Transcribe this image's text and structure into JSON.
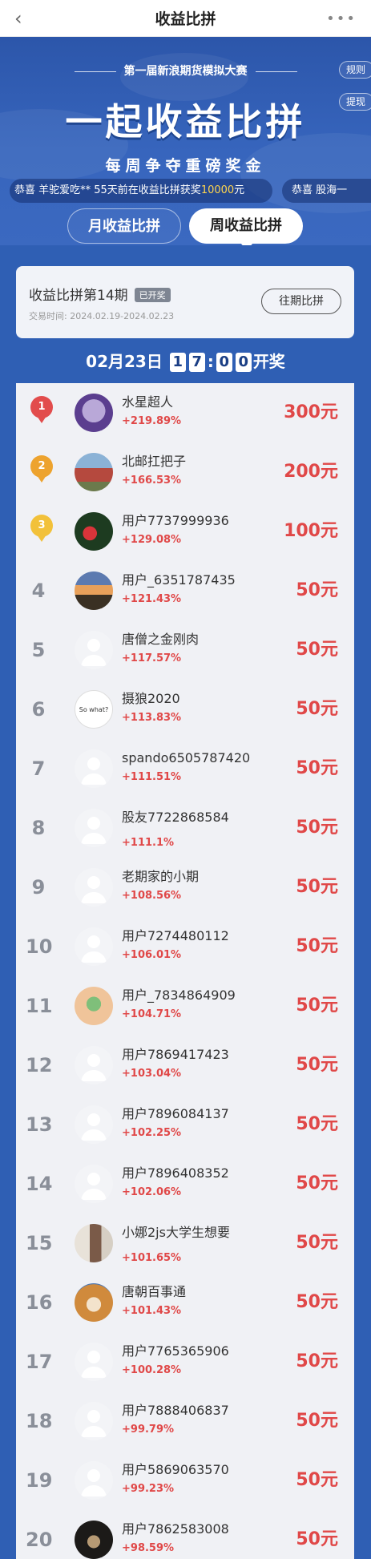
{
  "nav": {
    "back_icon": "back-chevron-icon",
    "title": "收益比拼",
    "more_icon": "more-dots-icon"
  },
  "hero": {
    "contest_title": "第一届新浪期货模拟大赛",
    "side_buttons": [
      "规则",
      "提现"
    ],
    "main_title": "一起收益比拼",
    "subtitle": "每周争夺重磅奖金",
    "marquee1": {
      "prefix": "恭喜 羊驼爱吃** 55天前在收益比拼获奖",
      "amount": "10000",
      "suffix": "元"
    },
    "marquee2": "恭喜 股海一"
  },
  "tabs": {
    "month": "月收益比拼",
    "week": "周收益比拼",
    "active": "week"
  },
  "period": {
    "title": "收益比拼第14期",
    "badge": "已开奖",
    "date": "交易时间: 2024.02.19-2024.02.23",
    "history_btn": "往期比拼"
  },
  "countdown": {
    "date": "02月23日",
    "digits": [
      "1",
      "7",
      "0",
      "0"
    ],
    "suffix": "开奖"
  },
  "colors": {
    "accent_red": "#e04848",
    "brand_blue": "#2f5fb4",
    "gold": "#f0a92a",
    "silver": "#e9a834",
    "bronze": "#f3c23a",
    "first": "#e24c4c"
  },
  "leaderboard": [
    {
      "rank": "1",
      "name": "水星超人",
      "pct": "+219.89%",
      "prize": "300元",
      "avatar": "cartoon-bear-avatar"
    },
    {
      "rank": "2",
      "name": "北邮扛把子",
      "pct": "+166.53%",
      "prize": "200元",
      "avatar": "building-photo-avatar"
    },
    {
      "rank": "3",
      "name": "用户7737999936",
      "pct": "+129.08%",
      "prize": "100元",
      "avatar": "strawberry-photo-avatar"
    },
    {
      "rank": "4",
      "name": "用户_6351787435",
      "pct": "+121.43%",
      "prize": "50元",
      "avatar": "sunset-photo-avatar"
    },
    {
      "rank": "5",
      "name": "唐僧之金刚肉",
      "pct": "+117.57%",
      "prize": "50元",
      "avatar": "default-user-avatar"
    },
    {
      "rank": "6",
      "name": "摄狼2020",
      "pct": "+113.83%",
      "prize": "50元",
      "avatar": "text-avatar",
      "avatar_text": "So what?"
    },
    {
      "rank": "7",
      "name": "spando6505787420",
      "pct": "+111.51%",
      "prize": "50元",
      "avatar": "default-user-avatar"
    },
    {
      "rank": "8",
      "name": "股友7722868584",
      "pct": "+111.1%",
      "prize": "50元",
      "avatar": "default-user-avatar"
    },
    {
      "rank": "9",
      "name": "老期家的小期",
      "pct": "+108.56%",
      "prize": "50元",
      "avatar": "default-user-avatar"
    },
    {
      "rank": "10",
      "name": "用户7274480112",
      "pct": "+106.01%",
      "prize": "50元",
      "avatar": "default-user-avatar"
    },
    {
      "rank": "11",
      "name": "用户_7834864909",
      "pct": "+104.71%",
      "prize": "50元",
      "avatar": "cartoon-avatar"
    },
    {
      "rank": "12",
      "name": "用户7869417423",
      "pct": "+103.04%",
      "prize": "50元",
      "avatar": "default-user-avatar"
    },
    {
      "rank": "13",
      "name": "用户7896084137",
      "pct": "+102.25%",
      "prize": "50元",
      "avatar": "default-user-avatar"
    },
    {
      "rank": "14",
      "name": "用户7896408352",
      "pct": "+102.06%",
      "prize": "50元",
      "avatar": "default-user-avatar"
    },
    {
      "rank": "15",
      "name": "小娜2js大学生想要",
      "pct": "+101.65%",
      "prize": "50元",
      "avatar": "person-photo-avatar"
    },
    {
      "rank": "16",
      "name": "唐朝百事通",
      "pct": "+101.43%",
      "prize": "50元",
      "avatar": "dog-photo-avatar"
    },
    {
      "rank": "17",
      "name": "用户7765365906",
      "pct": "+100.28%",
      "prize": "50元",
      "avatar": "default-user-avatar"
    },
    {
      "rank": "18",
      "name": "用户7888406837",
      "pct": "+99.79%",
      "prize": "50元",
      "avatar": "default-user-avatar"
    },
    {
      "rank": "19",
      "name": "用户5869063570",
      "pct": "+99.23%",
      "prize": "50元",
      "avatar": "default-user-avatar"
    },
    {
      "rank": "20",
      "name": "用户7862583008",
      "pct": "+98.59%",
      "prize": "50元",
      "avatar": "dark-photo-avatar"
    }
  ]
}
